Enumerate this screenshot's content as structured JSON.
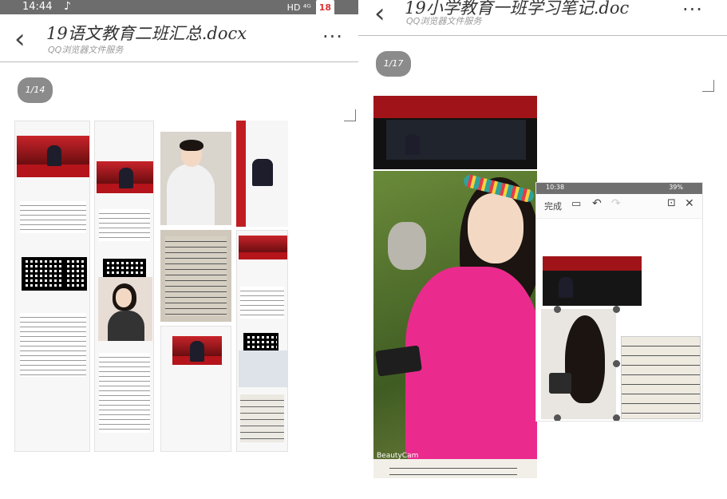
{
  "left": {
    "status": {
      "time": "14:44",
      "icons": "HD ⁴ᴳ",
      "battery": "18"
    },
    "title": "19语文教育二班汇总.docx",
    "subtitle": "QQ浏览器文件服务",
    "page_indicator": "1/14",
    "icons": {
      "back": "chevron-left-icon",
      "more": "more-dots-icon"
    }
  },
  "right": {
    "title": "19小学教育一班学习笔记.doc",
    "subtitle": "QQ浏览器文件服务",
    "page_indicator": "1/17",
    "editor": {
      "time": "10:38",
      "battery": "39%",
      "done_label": "完成"
    },
    "watermark": "BeautyCam",
    "icons": {
      "back": "chevron-left-icon",
      "more": "more-dots-icon"
    }
  }
}
